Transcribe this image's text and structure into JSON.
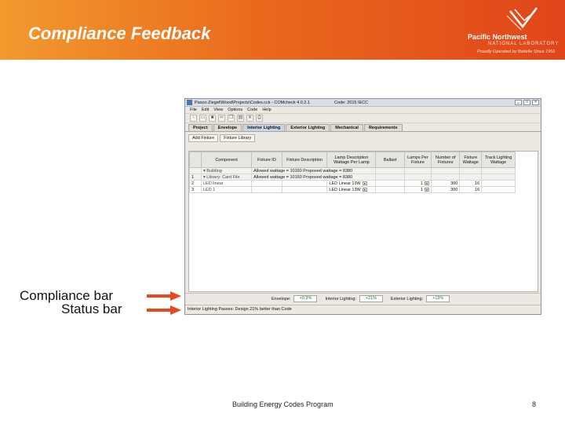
{
  "slide": {
    "title": "Compliance Feedback",
    "header_gradient": [
      "#f29a2e",
      "#e0451a"
    ]
  },
  "logo": {
    "name": "Pacific Northwest",
    "sub": "NATIONAL LABORATORY",
    "tagline": "Proudly Operated by Battelle Since 1965",
    "icon": "pnnl-logo-mark"
  },
  "app": {
    "title": "Pasco-Ziegel\\Wood\\Projects\\Codes.cck - COMcheck 4.0.2.1",
    "code": "Code: 2015 IECC",
    "menu": [
      "File",
      "Edit",
      "View",
      "Options",
      "Code",
      "Help"
    ],
    "toolbar_icons": [
      "new-file-icon",
      "open-folder-icon",
      "save-icon",
      "cut-icon",
      "copy-icon",
      "paste-icon",
      "delete-icon",
      "print-icon"
    ],
    "tabs": [
      {
        "label": "Project",
        "active": false
      },
      {
        "label": "Envelope",
        "active": false
      },
      {
        "label": "Interior Lighting",
        "active": true
      },
      {
        "label": "Exterior Lighting",
        "active": false
      },
      {
        "label": "Mechanical",
        "active": false
      },
      {
        "label": "Requirements",
        "active": false
      }
    ],
    "subtabs": [
      "Add Fixture",
      "Fixture Library"
    ],
    "table": {
      "headers": [
        "",
        "Component",
        "Fixture ID",
        "Fixture Description",
        "Lamp Description Wattage Per Lamp",
        "Ballast",
        "Lamps Per Fixture",
        "Number of Fixtures",
        "Fixture Wattage",
        "Track Lighting Wattage"
      ],
      "rows": [
        {
          "id": "",
          "component": "▾ Building",
          "fixture_id": "Allowed wattage = 10160   Proposed wattage = 8380",
          "desc": "",
          "lamp": "",
          "ballast": "",
          "lamps": "",
          "count": "",
          "fix_watt": "",
          "track": "",
          "group": true
        },
        {
          "id": "1",
          "component": "▾ Library: Card File",
          "fixture_id": "Allowed wattage = 10160   Proposed wattage = 8380",
          "desc": "",
          "lamp": "",
          "ballast": "",
          "lamps": "",
          "count": "",
          "fix_watt": "",
          "track": "",
          "group": true
        },
        {
          "id": "2",
          "component": "LED linear",
          "fixture_id": "",
          "desc": "",
          "lamp": "LED Linear 13W",
          "ballast": "",
          "lamps": "1",
          "count": "300",
          "fix_watt": "16",
          "track": "",
          "group": false
        },
        {
          "id": "3",
          "component": "LED 1",
          "fixture_id": "",
          "desc": "",
          "lamp": "LED Linear 13W",
          "ballast": "",
          "lamps": "1",
          "count": "300",
          "fix_watt": "16",
          "track": "",
          "group": false
        }
      ]
    },
    "compliance": {
      "envelope_label": "Envelope:",
      "envelope_value": "+0.9%",
      "interior_label": "Interior Lighting:",
      "interior_value": "+21%",
      "exterior_label": "Exterior Lighting:",
      "exterior_value": "+15%",
      "value_color": "#1f7a2f"
    },
    "status": "Interior Lighting Passes: Design 21% better than Code"
  },
  "annotations": {
    "compliance_bar": "Compliance bar",
    "status_bar": "Status bar",
    "arrow_color": "#e8481c"
  },
  "footer": {
    "text": "Building Energy Codes Program",
    "page": "8"
  }
}
